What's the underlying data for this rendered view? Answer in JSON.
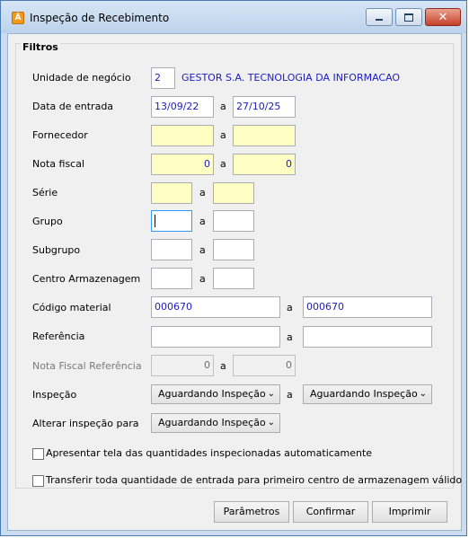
{
  "window": {
    "title": "Inspeção de Recebimento",
    "accent": "#4a7ab0"
  },
  "group": {
    "title": "Filtros"
  },
  "labels": {
    "unidade": "Unidade de negócio",
    "data_entrada": "Data de entrada",
    "fornecedor": "Fornecedor",
    "nota_fiscal": "Nota fiscal",
    "serie": "Série",
    "grupo": "Grupo",
    "subgrupo": "Subgrupo",
    "centro": "Centro Armazenagem",
    "codigo": "Código material",
    "referencia": "Referência",
    "nf_referencia": "Nota Fiscal  Referência",
    "inspecao": "Inspeção",
    "alterar": "Alterar inspeção para",
    "separator": "a"
  },
  "values": {
    "unidade_code": "2",
    "unidade_name": "GESTOR S.A. TECNOLOGIA DA INFORMACAO",
    "data_de": "13/09/22",
    "data_ate": "27/10/25",
    "fornecedor_de": "",
    "fornecedor_ate": "",
    "nf_de": "0",
    "nf_ate": "0",
    "serie_de": "",
    "serie_ate": "",
    "grupo_de": "",
    "grupo_ate": "",
    "subgrupo_de": "",
    "subgrupo_ate": "",
    "centro_de": "",
    "centro_ate": "",
    "codigo_de": "000670",
    "codigo_ate": "000670",
    "referencia_de": "",
    "referencia_ate": "",
    "nfref_de": "0",
    "nfref_ate": "0"
  },
  "selects": {
    "inspecao_de": "Aguardando Inspeção",
    "inspecao_ate": "Aguardando Inspeção",
    "alterar_para": "Aguardando Inspeção"
  },
  "checkboxes": {
    "apresentar": {
      "label": "Apresentar tela das quantidades inspecionadas automaticamente",
      "checked": false
    },
    "transferir": {
      "label": "Transferir toda quantidade de entrada para primeiro centro de armazenagem válido",
      "checked": false
    }
  },
  "buttons": {
    "parametros": "Parâmetros",
    "confirmar": "Confirmar",
    "imprimir": "Imprimir"
  },
  "icons": {
    "app": "app-logo-icon",
    "minimize": "minimize-icon",
    "maximize": "maximize-icon",
    "close": "close-icon",
    "dropdown": "chevron-down-icon"
  }
}
